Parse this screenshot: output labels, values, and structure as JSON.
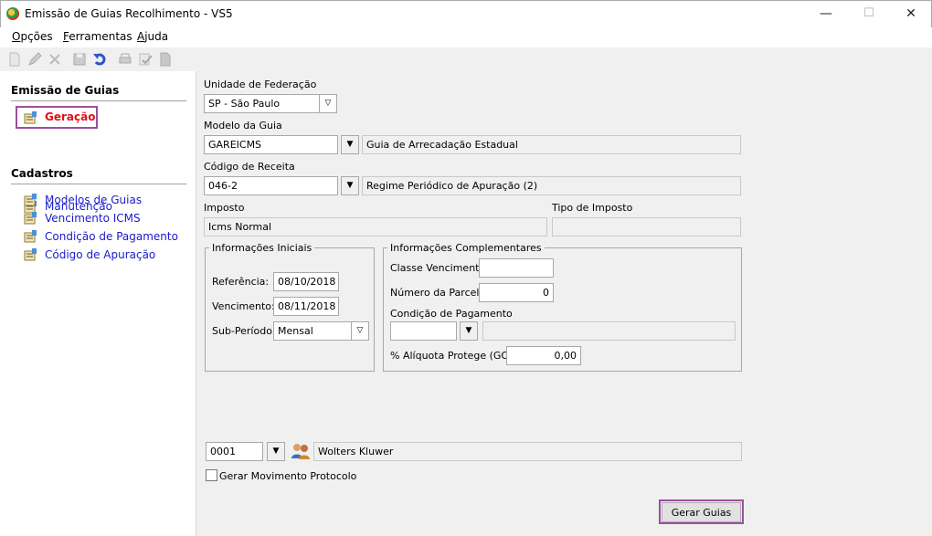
{
  "window": {
    "title": "Emissão de Guias Recolhimento - VS5",
    "minimize": "—",
    "maximize": "☐",
    "close": "✕"
  },
  "menu": [
    {
      "label": "Opções",
      "hotkey": "O"
    },
    {
      "label": "Ferramentas",
      "hotkey": "F"
    },
    {
      "label": "Ajuda",
      "hotkey": "A"
    }
  ],
  "toolbar": [
    "new-icon",
    "edit-icon",
    "delete-icon",
    "save-icon",
    "undo-icon",
    "print-icon",
    "check-icon",
    "document-icon"
  ],
  "sidebar": {
    "section1": {
      "title": "Emissão de Guias",
      "items": [
        {
          "label": "Geração",
          "selected": true
        },
        {
          "label": "Manutenção"
        }
      ]
    },
    "section2": {
      "title": "Cadastros",
      "items": [
        {
          "label": "Modelos de Guias"
        },
        {
          "label": "Vencimento ICMS"
        },
        {
          "label": "Condição de Pagamento"
        },
        {
          "label": "Código de Apuração"
        }
      ]
    }
  },
  "form": {
    "uf": {
      "label": "Unidade de Federação",
      "value": "SP - São Paulo"
    },
    "modelo": {
      "label": "Modelo da Guia",
      "value": "GAREICMS",
      "desc": "Guia de Arrecadação Estadual"
    },
    "codigo": {
      "label": "Código de Receita",
      "value": "046-2",
      "desc": "Regime Periódico de Apuração (2)"
    },
    "imposto": {
      "label": "Imposto",
      "value": "Icms Normal"
    },
    "tipo_imposto": {
      "label": "Tipo de Imposto",
      "value": ""
    },
    "info_iniciais": {
      "title": "Informações Iniciais",
      "referencia": {
        "label": "Referência:",
        "value": "08/10/2018"
      },
      "vencimento": {
        "label": "Vencimento:",
        "value": "08/11/2018"
      },
      "sub_periodo": {
        "label": "Sub-Período:",
        "value": "Mensal"
      }
    },
    "info_complementares": {
      "title": "Informações Complementares",
      "classe_vencimento": {
        "label": "Classe Vencimento:",
        "value": ""
      },
      "numero_parcela": {
        "label": "Número da Parcela:",
        "value": "0"
      },
      "condicao_pagamento": {
        "label": "Condição de Pagamento",
        "value": "",
        "desc": ""
      },
      "aliquota": {
        "label": "% Alíquota Protege (GO):",
        "value": "0,00"
      }
    },
    "empresa": {
      "code": "0001",
      "name": "Wolters Kluwer"
    },
    "gerar_movimento": {
      "label": "Gerar Movimento Protocolo",
      "checked": false
    },
    "gerar_button": "Gerar Guias"
  },
  "colors": {
    "highlight": "#9b4f9f",
    "selected_text": "#e0101a",
    "link_text": "#1a1acc"
  }
}
